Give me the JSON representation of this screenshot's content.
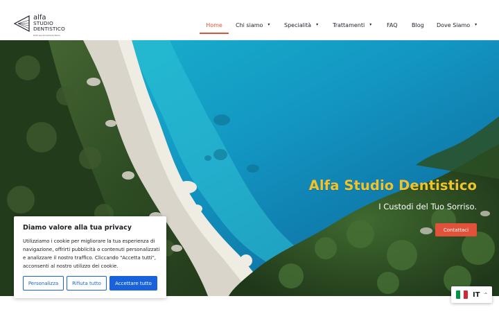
{
  "brand": {
    "line1": "alfa",
    "line2": "STUDIO",
    "line3": "DENTISTICO",
    "tagline": "Dott.ssa Annamaria Paolo"
  },
  "nav": {
    "items": [
      {
        "label": "Home",
        "active": true,
        "has_dropdown": false
      },
      {
        "label": "Chi siamo",
        "active": false,
        "has_dropdown": true
      },
      {
        "label": "Specialità",
        "active": false,
        "has_dropdown": true
      },
      {
        "label": "Trattamenti",
        "active": false,
        "has_dropdown": true
      },
      {
        "label": "FAQ",
        "active": false,
        "has_dropdown": false
      },
      {
        "label": "Blog",
        "active": false,
        "has_dropdown": false
      },
      {
        "label": "Dove Siamo",
        "active": false,
        "has_dropdown": true
      }
    ],
    "caret_icon": "▾"
  },
  "hero": {
    "title": "Alfa Studio Dentistico",
    "subtitle": "I Custodi del Tuo Sorriso.",
    "cta_label": "Contattaci"
  },
  "cookie_banner": {
    "title": "Diamo valore alla tua privacy",
    "text": "Utilizziamo i cookie per migliorare la tua esperienza di navigazione, offrirti pubblicità o contenuti personalizzati e analizzare il nostro traffico. Cliccando \"Accetta tutti\", acconsenti al nostro utilizzo dei cookie.",
    "customize_label": "Personalizza",
    "reject_label": "Rifiuta tutto",
    "accept_label": "Accettare tutto"
  },
  "language": {
    "code": "IT",
    "caret_icon": "^",
    "flag_icon": "italy-flag-icon"
  },
  "colors": {
    "accent": "#e2523a",
    "hero_title": "#f0c32d",
    "cookie_button": "#1863dc",
    "text_dark": "#1d1f2a"
  }
}
